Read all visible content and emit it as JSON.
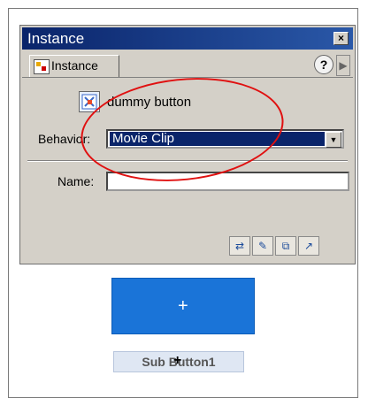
{
  "window": {
    "title": "Instance",
    "close_label": "×"
  },
  "tabs": {
    "active_label": "Instance"
  },
  "help_label": "?",
  "symbol": {
    "name": "dummy button"
  },
  "behavior": {
    "label": "Behavior:",
    "selected": "Movie Clip"
  },
  "name_field": {
    "label": "Name:",
    "value": ""
  },
  "stage": {
    "plus": "+",
    "button_text": "Sub Button1"
  },
  "colors": {
    "title_bar": "#0a246a",
    "selection": "#0a246a",
    "annotation": "#e01010",
    "blue_button": "#1a74d8"
  },
  "icons": [
    "instance-icon",
    "button-symbol-icon",
    "chevron-down-icon",
    "help-icon",
    "swap-symbol-icon",
    "edit-icon",
    "duplicate-icon",
    "expand-icon"
  ]
}
